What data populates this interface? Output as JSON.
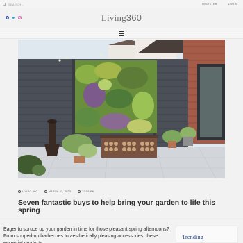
{
  "topbar": {
    "search_label": "SEARCH...",
    "register_label": "REGISTER",
    "login_label": "LOGIN"
  },
  "brand": {
    "name_text": "Living",
    "name_number": "360"
  },
  "social": [
    "facebook-icon",
    "twitter-icon",
    "instagram-icon"
  ],
  "article": {
    "author": "LIVING 360",
    "date": "MARCH 23, 2023",
    "time": "12:09 PM",
    "headline": "Seven fantastic buys to help bring your garden to life this spring",
    "excerpt": "Eager to spruce up your garden in time for those pleasant spring afternoons? From souped-up barbecues to aesthetically pleasing accessories, these essential products"
  },
  "sidebar": {
    "trending_title": "Trending"
  },
  "colors": {
    "accent": "#2e4d84",
    "fence": "#4a4e57",
    "green_wall": "#5f8a3a"
  }
}
